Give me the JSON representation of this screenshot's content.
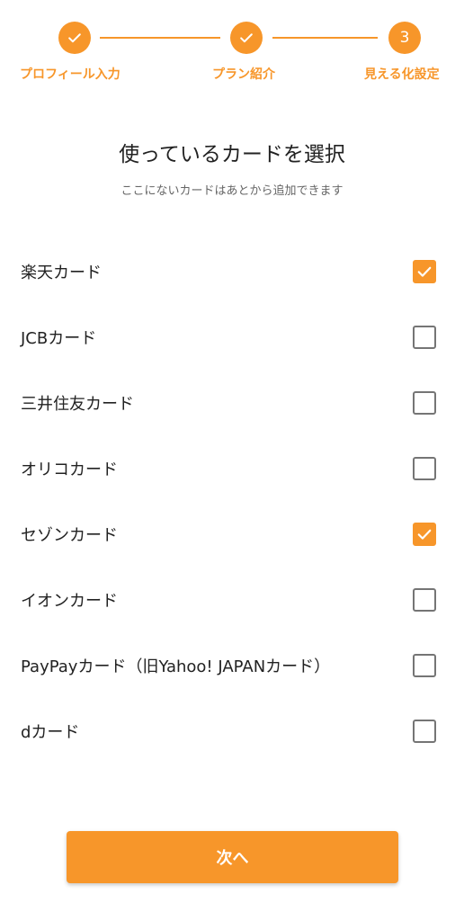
{
  "stepper": {
    "steps": [
      {
        "label": "プロフィール入力",
        "state": "completed",
        "icon": "check-icon"
      },
      {
        "label": "プラン紹介",
        "state": "completed",
        "icon": "check-icon"
      },
      {
        "label": "見える化設定",
        "state": "current",
        "number": "3"
      }
    ]
  },
  "header": {
    "title": "使っているカードを選択",
    "subtitle": "ここにないカードはあとから追加できます"
  },
  "cards": [
    {
      "label": "楽天カード",
      "checked": true
    },
    {
      "label": "JCBカード",
      "checked": false
    },
    {
      "label": "三井住友カード",
      "checked": false
    },
    {
      "label": "オリコカード",
      "checked": false
    },
    {
      "label": "セゾンカード",
      "checked": true
    },
    {
      "label": "イオンカード",
      "checked": false
    },
    {
      "label": "PayPayカード（旧Yahoo! JAPANカード）",
      "checked": false
    },
    {
      "label": "dカード",
      "checked": false
    }
  ],
  "footer": {
    "next_label": "次へ"
  },
  "colors": {
    "accent": "#F7962A",
    "checkbox_border": "#757575",
    "text": "#222222",
    "subtext": "#666666"
  }
}
